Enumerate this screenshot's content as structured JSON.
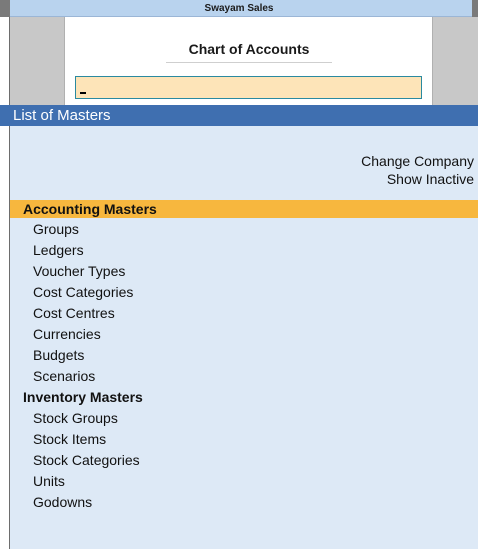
{
  "app": {
    "company_name": "Swayam Sales"
  },
  "dialog": {
    "title": "Chart of Accounts",
    "select_value": ""
  },
  "list": {
    "title": "List of Masters",
    "options": {
      "change_company": "Change Company",
      "show_inactive": "Show Inactive"
    },
    "accounting": {
      "heading": "Accounting Masters",
      "items": [
        "Groups",
        "Ledgers",
        "Voucher Types",
        "Cost Categories",
        "Cost Centres",
        "Currencies",
        "Budgets",
        "Scenarios"
      ]
    },
    "inventory": {
      "heading": "Inventory Masters",
      "items": [
        "Stock Groups",
        "Stock Items",
        "Stock Categories",
        "Units",
        "Godowns"
      ]
    }
  },
  "colors": {
    "header_blue": "#3f6fb0",
    "list_background": "#dde9f6",
    "highlight_orange": "#f7b73e",
    "input_background": "#fde4b8"
  }
}
